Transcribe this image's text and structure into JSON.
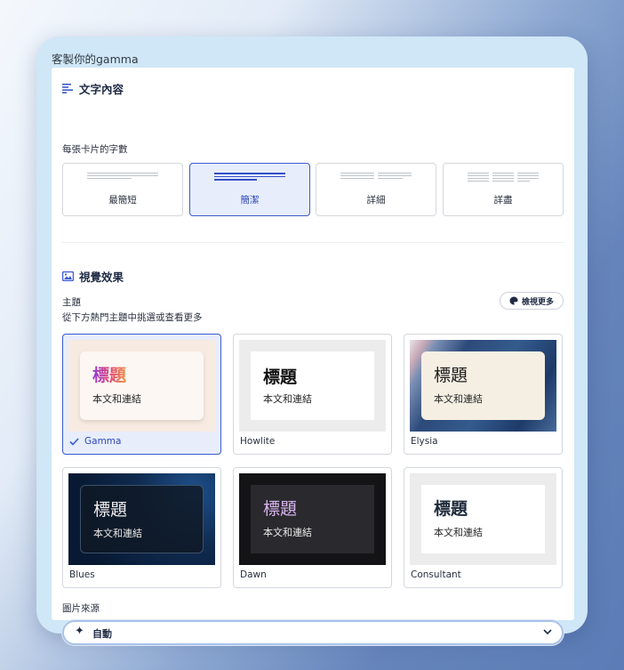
{
  "panel": {
    "title": "客製你的gamma"
  },
  "text_section": {
    "heading": "文字內容",
    "subheading": "每張卡片的字數",
    "options": [
      {
        "label": "最簡短",
        "selected": false
      },
      {
        "label": "簡潔",
        "selected": true
      },
      {
        "label": "詳細",
        "selected": false
      },
      {
        "label": "詳盡",
        "selected": false
      }
    ]
  },
  "visual_section": {
    "heading": "視覺效果",
    "theme_label": "主題",
    "theme_hint": "從下方熱門主題中挑選或查看更多",
    "view_more": "檢視更多",
    "themes": [
      {
        "name": "Gamma",
        "title": "標題",
        "body": "本文和連結",
        "selected": true
      },
      {
        "name": "Howlite",
        "title": "標題",
        "body": "本文和連結",
        "selected": false
      },
      {
        "name": "Elysia",
        "title": "標題",
        "body": "本文和連結",
        "selected": false
      },
      {
        "name": "Blues",
        "title": "標題",
        "body": "本文和連結",
        "selected": false
      },
      {
        "name": "Dawn",
        "title": "標題",
        "body": "本文和連結",
        "selected": false
      },
      {
        "name": "Consultant",
        "title": "標題",
        "body": "本文和連結",
        "selected": false
      }
    ],
    "image_source_label": "圖片來源",
    "image_source_value": "自動"
  },
  "colors": {
    "accent": "#3b5ad0",
    "panel_bg": "#cfe7f7"
  }
}
